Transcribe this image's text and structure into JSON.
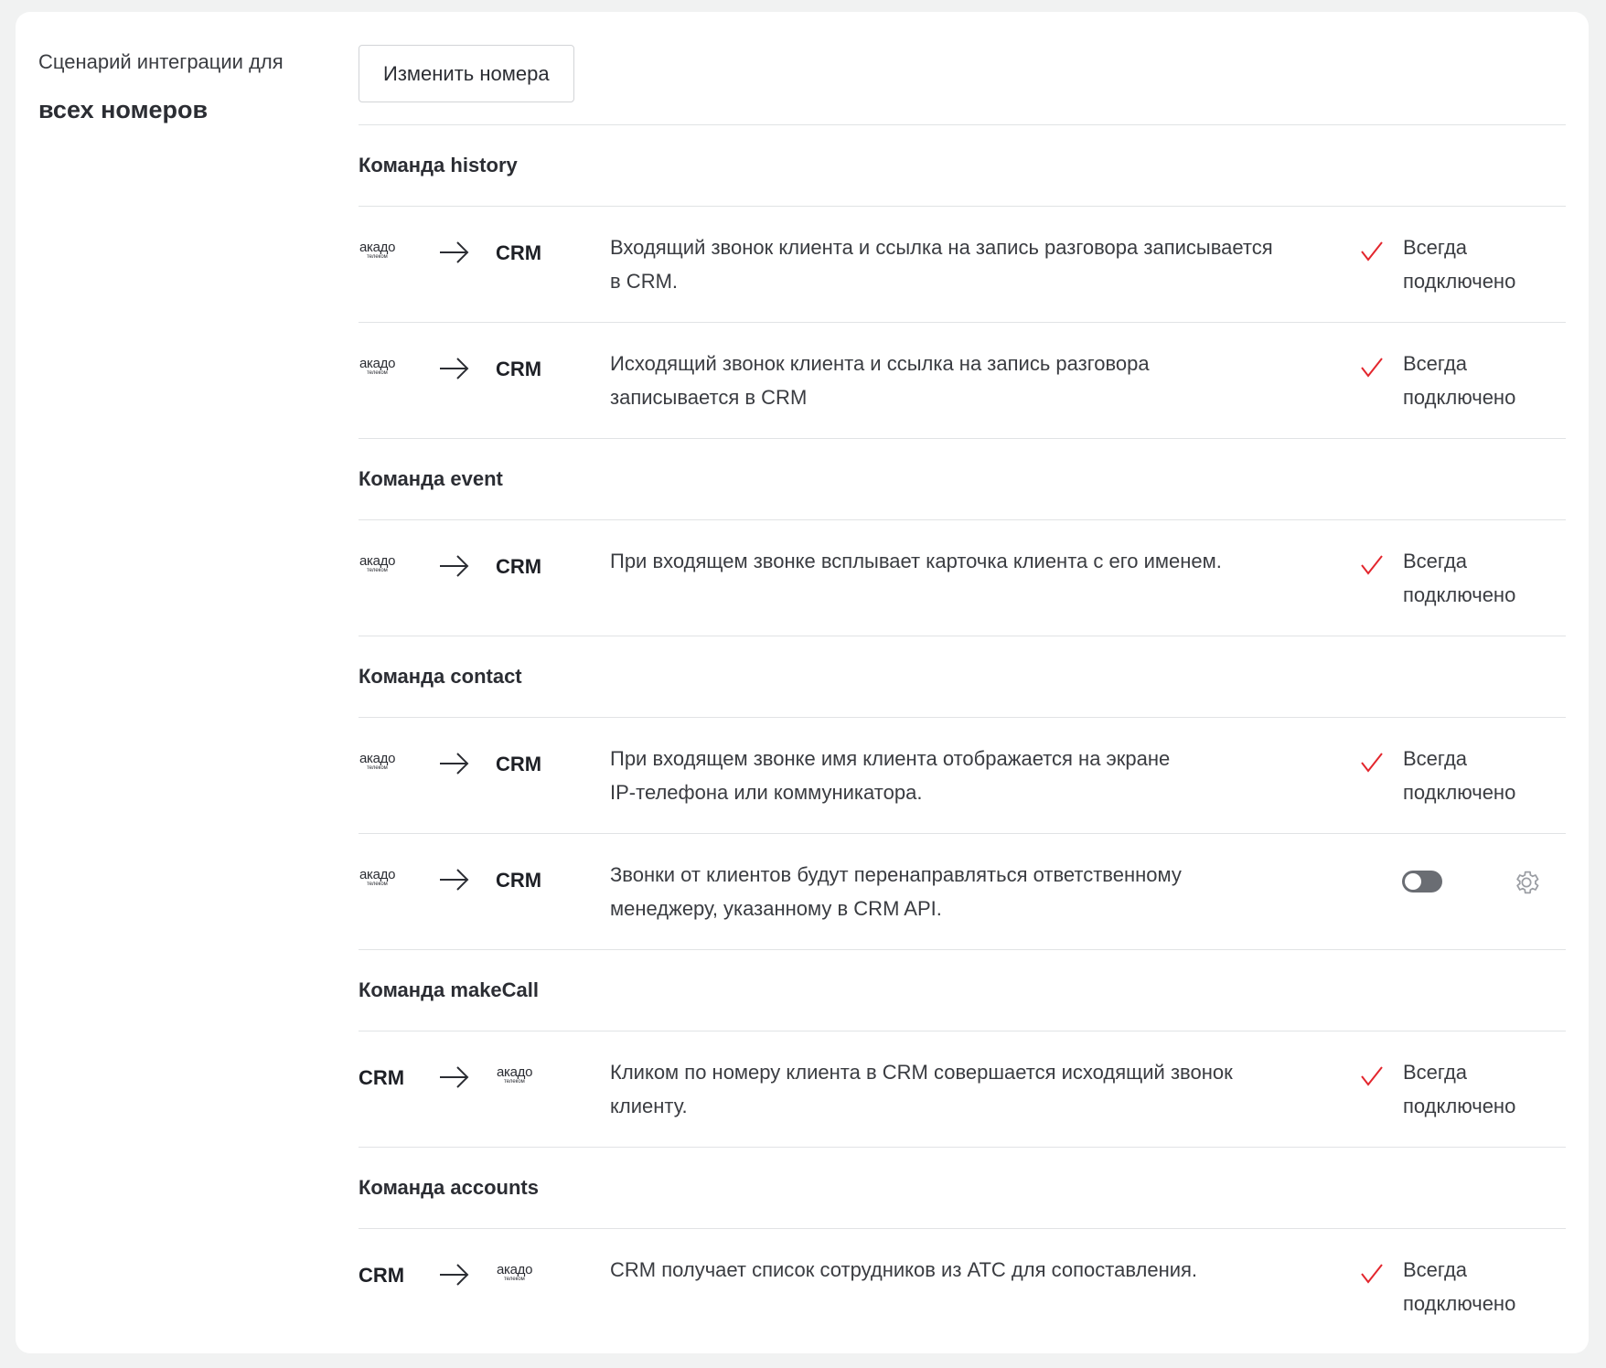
{
  "sidebar": {
    "subtitle": "Сценарий интеграции для",
    "title": "всех номеров"
  },
  "toolbar": {
    "change_numbers_label": "Изменить номера"
  },
  "brand": {
    "logo_main": "акадо",
    "logo_sub": "телеком",
    "accent_color": "#e3262d"
  },
  "sections": [
    {
      "header": "Команда history",
      "rows": [
        {
          "from": "logo",
          "to": "CRM",
          "desc_line1": "Входящий звонок клиента и ссылка на запись разговора записывается",
          "desc_line2": "в CRM.",
          "status_line1": "Всегда",
          "status_line2": "подключено",
          "mode": "always"
        },
        {
          "from": "logo",
          "to": "CRM",
          "desc_line1": "Исходящий звонок клиента и ссылка на запись разговора",
          "desc_line2": "записывается в CRM",
          "status_line1": "Всегда",
          "status_line2": "подключено",
          "mode": "always"
        }
      ]
    },
    {
      "header": "Команда event",
      "rows": [
        {
          "from": "logo",
          "to": "CRM",
          "desc_line1": "При входящем звонке всплывает карточка клиента с его именем.",
          "desc_line2": "",
          "status_line1": "Всегда",
          "status_line2": "подключено",
          "mode": "always"
        }
      ]
    },
    {
      "header": "Команда contact",
      "rows": [
        {
          "from": "logo",
          "to": "CRM",
          "desc_line1": "При входящем звонке имя клиента отображается на экране",
          "desc_line2": "IP-телефона или коммуникатора.",
          "status_line1": "Всегда",
          "status_line2": "подключено",
          "mode": "always"
        },
        {
          "from": "logo",
          "to": "CRM",
          "desc_line1": "Звонки от клиентов будут перенаправляться ответственному",
          "desc_line2": "менеджеру, указанному в CRM API.",
          "status_line1": "",
          "status_line2": "",
          "mode": "toggle",
          "toggle_on": false
        }
      ]
    },
    {
      "header": "Команда makeCall",
      "rows": [
        {
          "from": "CRM",
          "to": "logo",
          "desc_line1": "Кликом по номеру клиента в CRM совершается исходящий звонок",
          "desc_line2": "клиенту.",
          "status_line1": "Всегда",
          "status_line2": "подключено",
          "mode": "always"
        }
      ]
    },
    {
      "header": "Команда accounts",
      "rows": [
        {
          "from": "CRM",
          "to": "logo",
          "desc_line1": "CRM получает список сотрудников из АТС для сопоставления.",
          "desc_line2": "",
          "status_line1": "Всегда",
          "status_line2": "подключено",
          "mode": "always"
        }
      ]
    }
  ]
}
